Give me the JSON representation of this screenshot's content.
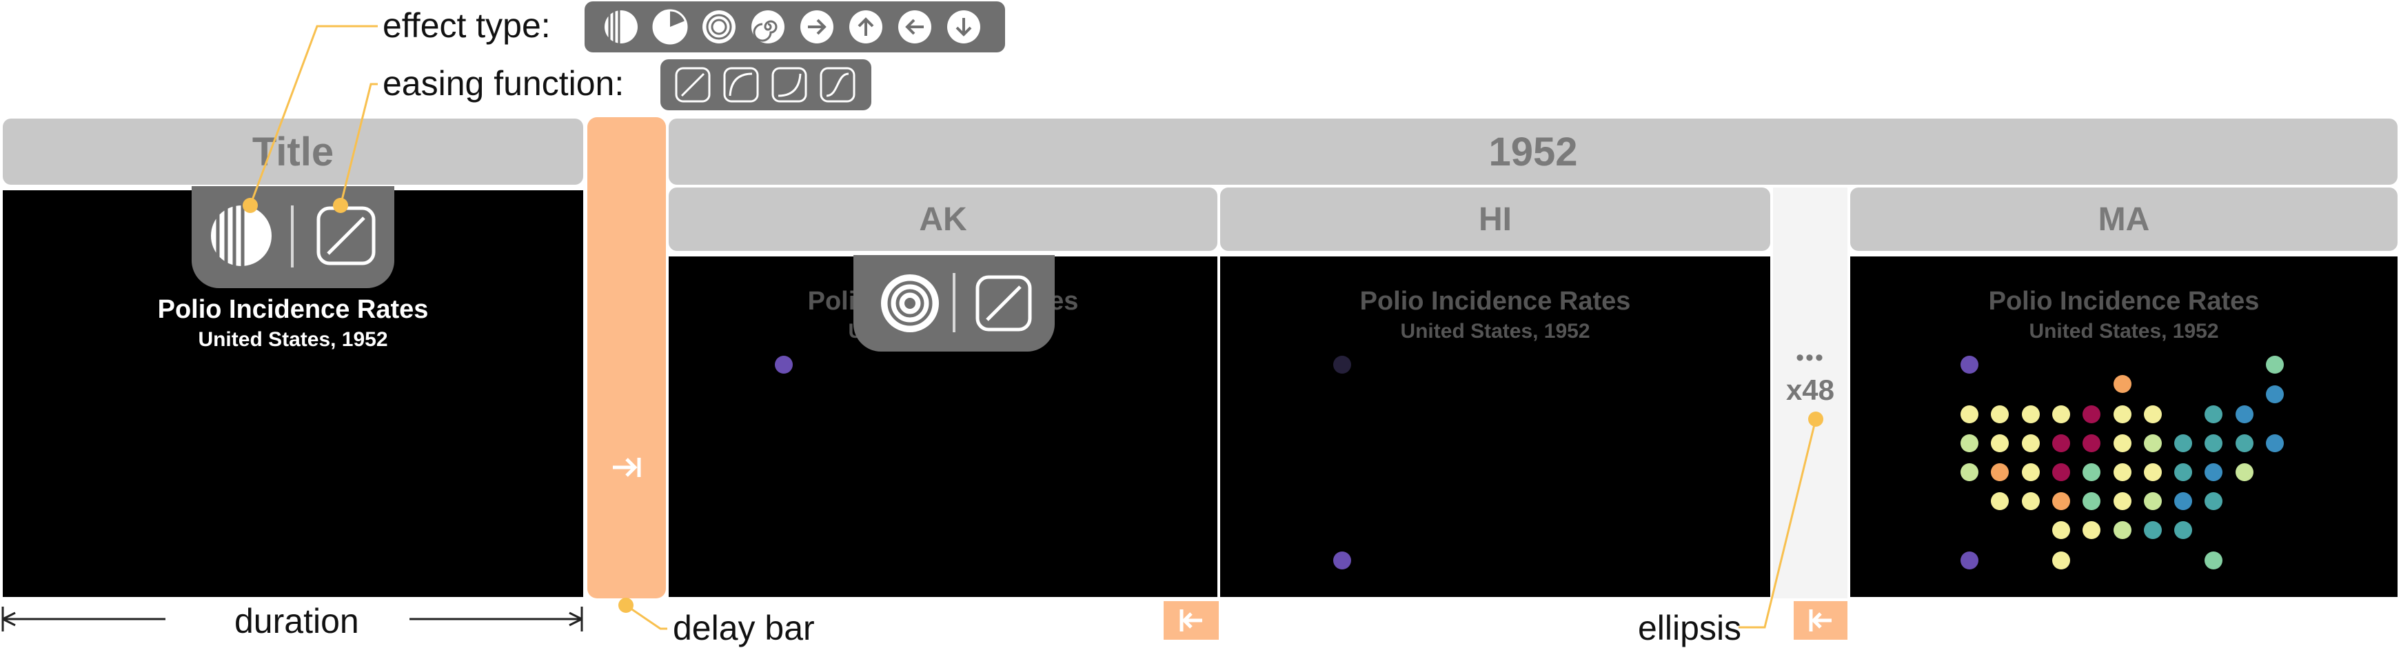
{
  "annotations": {
    "effect_type": "effect type:",
    "easing_function": "easing function:",
    "duration": "duration",
    "delay_bar": "delay bar",
    "ellipsis": "ellipsis"
  },
  "effect_icons": [
    "wipe-fade-icon",
    "pie-wipe-icon",
    "concentric-icon",
    "spiral-icon",
    "arrow-right-icon",
    "arrow-up-icon",
    "arrow-left-icon",
    "arrow-down-icon"
  ],
  "easing_icons": [
    "linear-easing-icon",
    "ease-out-icon",
    "ease-in-icon",
    "ease-in-out-icon"
  ],
  "headers": {
    "title": "Title",
    "year": "1952",
    "states": [
      "AK",
      "HI",
      "MA"
    ]
  },
  "frame_text": {
    "title": "Polio Incidence Rates",
    "subtitle": "United States, 1952"
  },
  "ellipsis": {
    "dots": "•••",
    "count": "x48"
  },
  "colors": {
    "accent": "#f8c04f",
    "delay_bar": "#fdbb8a",
    "toolbar": "#6f6f6f",
    "header": "#c8c8c8"
  }
}
